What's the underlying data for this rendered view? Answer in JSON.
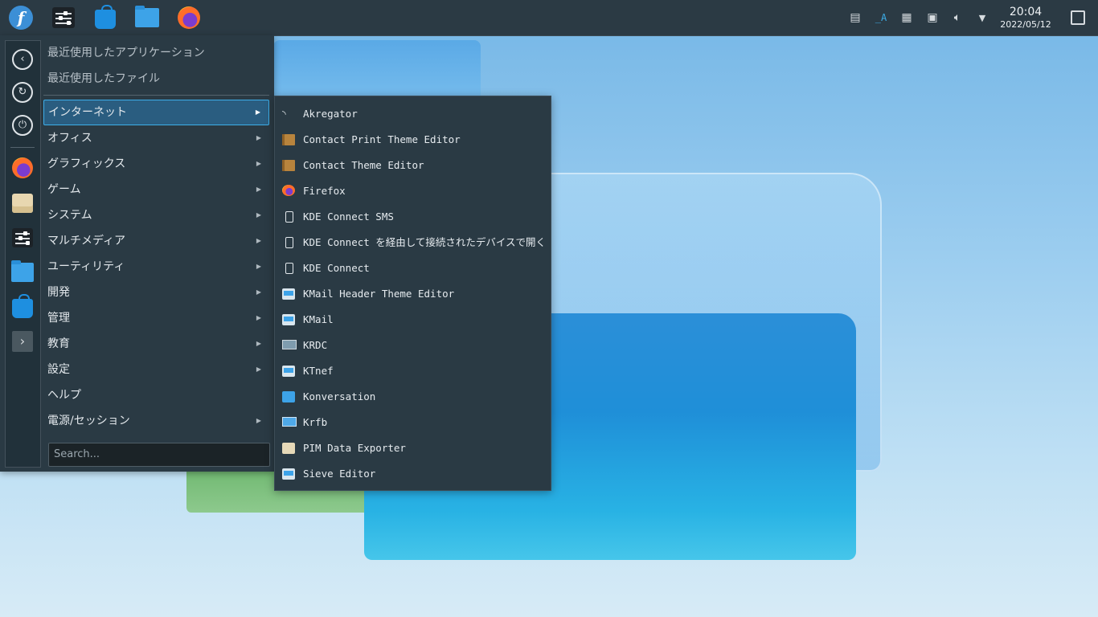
{
  "panel": {
    "launchers": [
      "fedora-logo-icon",
      "system-settings-icon",
      "discover-icon",
      "file-manager-icon",
      "firefox-icon"
    ],
    "tray": [
      "clipboard-icon",
      "keyboard-layout-icon",
      "notes-icon",
      "network-icon",
      "volume-icon",
      "expand-tray-icon"
    ],
    "keyboard_label": "_A",
    "clock": {
      "time": "20:04",
      "date": "2022/05/12"
    }
  },
  "menu": {
    "sidebar": [
      "back-icon",
      "restart-icon",
      "power-icon",
      "firefox-icon",
      "archive-icon",
      "system-settings-icon",
      "file-manager-icon",
      "discover-icon",
      "more-icon"
    ],
    "recent": [
      {
        "label": "最近使用したアプリケーション"
      },
      {
        "label": "最近使用したファイル"
      }
    ],
    "categories": [
      {
        "label": "インターネット",
        "has_sub": true,
        "active": true
      },
      {
        "label": "オフィス",
        "has_sub": true
      },
      {
        "label": "グラフィックス",
        "has_sub": true
      },
      {
        "label": "ゲーム",
        "has_sub": true
      },
      {
        "label": "システム",
        "has_sub": true
      },
      {
        "label": "マルチメディア",
        "has_sub": true
      },
      {
        "label": "ユーティリティ",
        "has_sub": true
      },
      {
        "label": "開発",
        "has_sub": true
      },
      {
        "label": "管理",
        "has_sub": true
      },
      {
        "label": "教育",
        "has_sub": true
      },
      {
        "label": "設定",
        "has_sub": true
      },
      {
        "label": "ヘルプ",
        "has_sub": false
      },
      {
        "label": "電源/セッション",
        "has_sub": true
      }
    ],
    "search": {
      "placeholder": "Search...",
      "value": ""
    }
  },
  "submenu": {
    "items": [
      {
        "label": "Akregator",
        "icon": "rss-icon"
      },
      {
        "label": "Contact Print Theme Editor",
        "icon": "book-icon"
      },
      {
        "label": "Contact Theme Editor",
        "icon": "book-icon"
      },
      {
        "label": "Firefox",
        "icon": "firefox-icon"
      },
      {
        "label": "KDE Connect SMS",
        "icon": "phone-icon"
      },
      {
        "label": "KDE Connect を経由して接続されたデバイスで開く",
        "icon": "phone-icon"
      },
      {
        "label": "KDE Connect",
        "icon": "phone-icon"
      },
      {
        "label": "KMail Header Theme Editor",
        "icon": "mail-icon"
      },
      {
        "label": "KMail",
        "icon": "mail-icon"
      },
      {
        "label": "KRDC",
        "icon": "monitor-icon"
      },
      {
        "label": "KTnef",
        "icon": "mail-icon"
      },
      {
        "label": "Konversation",
        "icon": "chat-icon"
      },
      {
        "label": "Krfb",
        "icon": "desktop-share-icon"
      },
      {
        "label": "PIM Data Exporter",
        "icon": "archive-icon"
      },
      {
        "label": "Sieve Editor",
        "icon": "mail-icon"
      }
    ]
  }
}
